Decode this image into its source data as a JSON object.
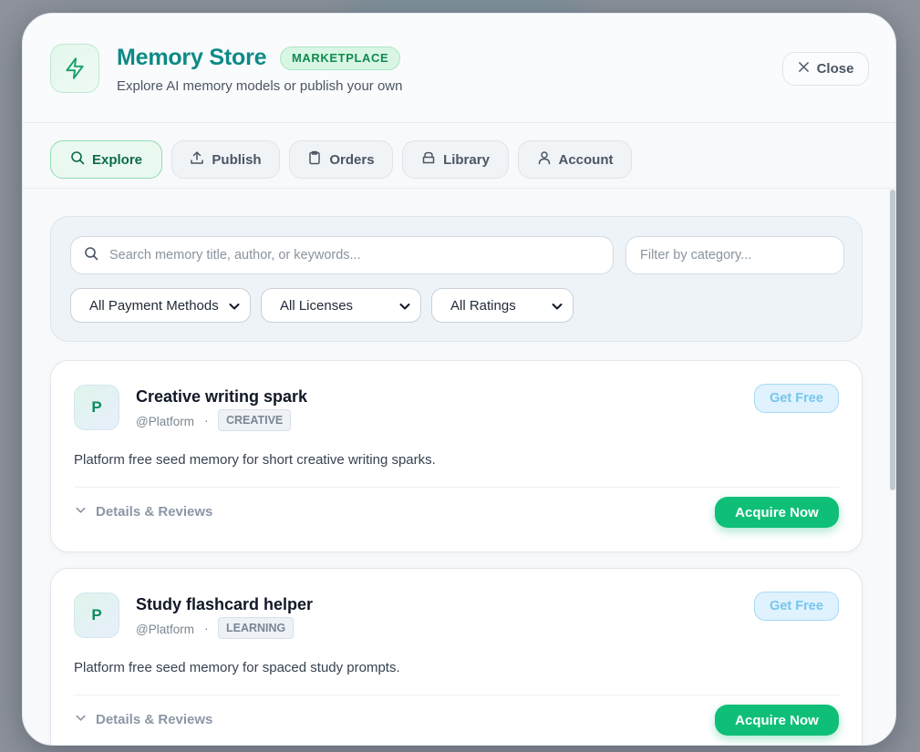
{
  "header": {
    "title": "Memory Store",
    "badge": "MARKETPLACE",
    "subtitle": "Explore AI memory models or publish your own",
    "close_label": "Close",
    "logo_icon": "lightning-icon"
  },
  "tabs": [
    {
      "label": "Explore",
      "icon": "search-icon",
      "active": true
    },
    {
      "label": "Publish",
      "icon": "upload-icon",
      "active": false
    },
    {
      "label": "Orders",
      "icon": "clipboard-icon",
      "active": false
    },
    {
      "label": "Library",
      "icon": "archive-icon",
      "active": false
    },
    {
      "label": "Account",
      "icon": "user-icon",
      "active": false
    }
  ],
  "filters": {
    "search_placeholder": "Search memory title, author, or keywords...",
    "category_placeholder": "Filter by category...",
    "payment_selected": "All Payment Methods",
    "license_selected": "All Licenses",
    "rating_selected": "All Ratings"
  },
  "cards": [
    {
      "avatar": "P",
      "title": "Creative writing spark",
      "author": "@Platform",
      "tag": "CREATIVE",
      "price_label": "Get Free",
      "description": "Platform free seed memory for short creative writing sparks.",
      "details_label": "Details & Reviews",
      "action_label": "Acquire Now"
    },
    {
      "avatar": "P",
      "title": "Study flashcard helper",
      "author": "@Platform",
      "tag": "LEARNING",
      "price_label": "Get Free",
      "description": "Platform free seed memory for spaced study prompts.",
      "details_label": "Details & Reviews",
      "action_label": "Acquire Now"
    }
  ],
  "colors": {
    "accent": "#0fbf78",
    "title": "#0d8a86",
    "badge_bg": "#d9f6e4"
  }
}
